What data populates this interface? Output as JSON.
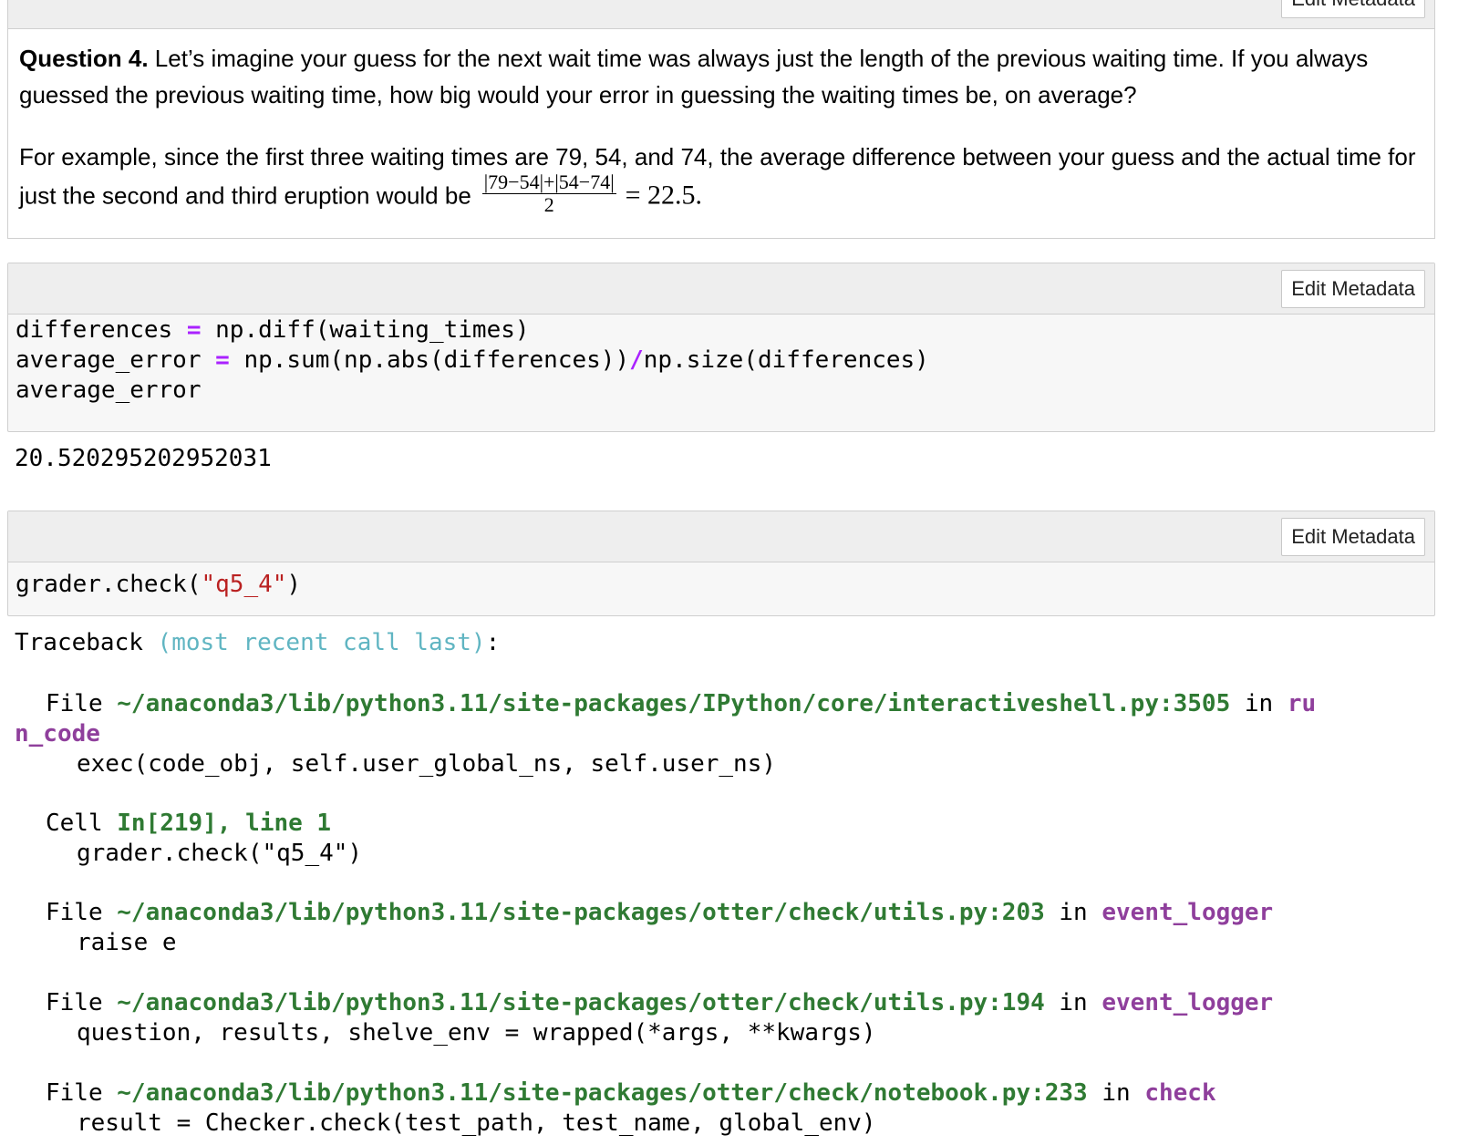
{
  "metadata_button_label": "Edit Metadata",
  "question": {
    "label": "Question 4.",
    "text": " Let’s imagine your guess for the next wait time was always just the length of the previous waiting time. If you always guessed the previous waiting time, how big would your error in guessing the waiting times be, on average?",
    "example_text": "For example, since the first three waiting times are 79, 54, and 74, the average difference between your guess and the actual time for just the second and third eruption would be",
    "fraction_numerator": "|79−54|+|54−74|",
    "fraction_denominator": "2",
    "fraction_result": "= 22.5."
  },
  "code_cell_1": {
    "line1_a": "differences ",
    "line1_op": "=",
    "line1_b": " np.diff(waiting_times)",
    "line2_a": "average_error ",
    "line2_op": "=",
    "line2_b": " np.sum(np.abs(differences))",
    "line2_op2": "/",
    "line2_c": "np.size(differences)",
    "line3": "average_error",
    "output": "20.520295202952031"
  },
  "code_cell_2": {
    "code_a": "grader.check(",
    "code_str": "\"q5_4\"",
    "code_b": ")"
  },
  "traceback": {
    "header": "Traceback ",
    "header_cyan": "(most recent call last)",
    "header_colon": ":",
    "frames": [
      {
        "file_kw": "File ",
        "path": "~/anaconda3/lib/python3.11/site-packages/IPython/core/interactiveshell.py:3505",
        "in_kw": " in ",
        "func_part1": "ru",
        "func_part2": "n_code",
        "code": "exec(code_obj, self.user_global_ns, self.user_ns)"
      },
      {
        "cell_kw": "Cell ",
        "cell_ref": "In[219], line 1",
        "code": "grader.check(\"q5_4\")"
      },
      {
        "file_kw": "File ",
        "path": "~/anaconda3/lib/python3.11/site-packages/otter/check/utils.py:203",
        "in_kw": " in ",
        "func": "event_logger",
        "code": "raise e"
      },
      {
        "file_kw": "File ",
        "path": "~/anaconda3/lib/python3.11/site-packages/otter/check/utils.py:194",
        "in_kw": " in ",
        "func": "event_logger",
        "code": "question, results, shelve_env = wrapped(*args, **kwargs)"
      },
      {
        "file_kw": "File ",
        "path": "~/anaconda3/lib/python3.11/site-packages/otter/check/notebook.py:233",
        "in_kw": " in ",
        "func": "check",
        "code": "result = Checker.check(test_path, test_name, global_env)"
      }
    ]
  }
}
